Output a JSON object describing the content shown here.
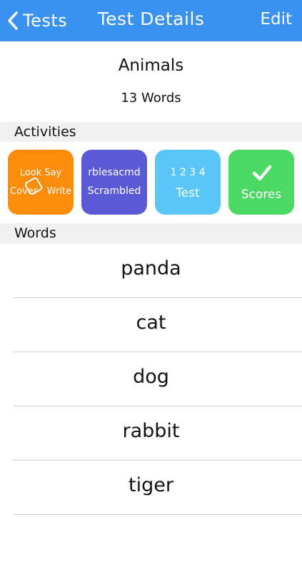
{
  "nav": {
    "back_label": "Tests",
    "title": "Test Details",
    "edit_label": "Edit"
  },
  "test": {
    "name": "Animals",
    "word_count": "13 Words"
  },
  "sections": {
    "activities": "Activities",
    "words": "Words"
  },
  "activities": {
    "lscw": {
      "line1": "Look Say",
      "line2_left": "Cover",
      "line2_right": "Write"
    },
    "scrambled": {
      "line1": "rblesacmd",
      "line2": "Scrambled"
    },
    "test": {
      "line1": "1 2 3 4",
      "line2": "Test"
    },
    "scores": {
      "label": "Scores"
    }
  },
  "words": [
    "panda",
    "cat",
    "dog",
    "rabbit",
    "tiger",
    ""
  ],
  "colors": {
    "nav_bar": "#3a92f0",
    "look_say_cover_write": "#fb8c0c",
    "scrambled": "#5a5ad6",
    "test": "#5ac6f8",
    "scores": "#4cd864"
  },
  "icons": {
    "back": "chevron-left-icon",
    "cover": "cover-square-icon",
    "scores": "checkmark-icon"
  }
}
